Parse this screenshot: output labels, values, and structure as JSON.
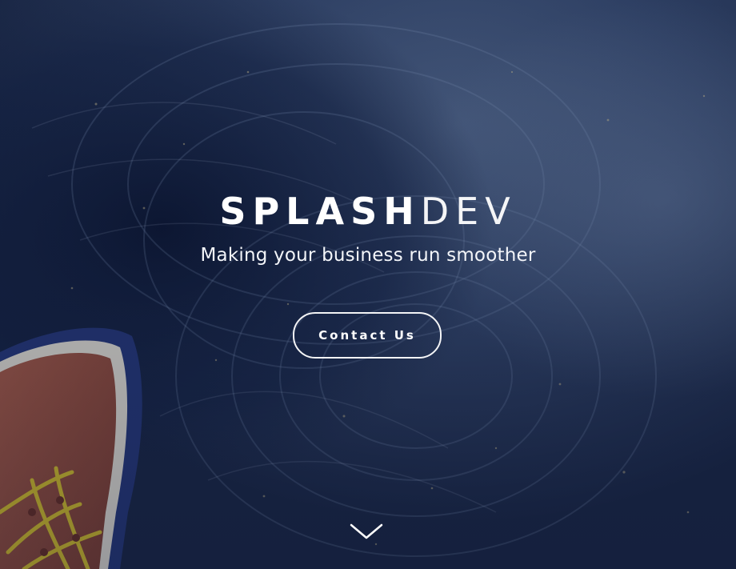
{
  "hero": {
    "logo": {
      "bold_part": "SPLASH",
      "light_part": "DEV"
    },
    "tagline": "Making your business run smoother",
    "cta_label": "Contact Us",
    "scroll_icon": "chevron-down-icon"
  },
  "colors": {
    "overlay": "#1c2d4a",
    "water_dark": "#0e1a34",
    "shoe_leather": "#9a5240",
    "shoe_rubber": "#2a3e7a",
    "laces": "#d8c22a",
    "text": "#ffffff"
  }
}
